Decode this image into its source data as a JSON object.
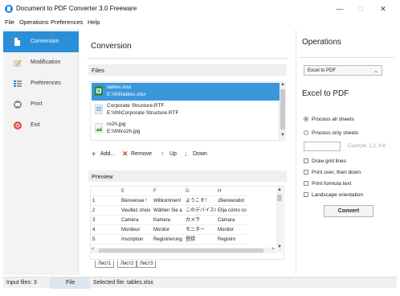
{
  "window": {
    "title": "Document to PDF Converter 3.0 Freeware",
    "min_glyph": "—",
    "max_glyph": "□",
    "close_glyph": "✕"
  },
  "menu": [
    "File",
    "Operations",
    "Preferences",
    "Help"
  ],
  "sidebar": {
    "items": [
      {
        "label": "Conversion",
        "icon": "conversion-icon",
        "active": true
      },
      {
        "label": "Modification",
        "icon": "pencil-icon",
        "active": false
      },
      {
        "label": "Preferences",
        "icon": "preferences-icon",
        "active": false
      },
      {
        "label": "Print",
        "icon": "printer-icon",
        "active": false
      },
      {
        "label": "Exit",
        "icon": "exit-icon",
        "active": false
      }
    ]
  },
  "main": {
    "heading": "Conversion",
    "files_label": "Files",
    "files": [
      {
        "name": "tables.xlsx",
        "path": "E:\\\\IN\\tables.xlsx",
        "selected": true,
        "icon": "excel-file-icon"
      },
      {
        "name": "Corporate Structure.RTF",
        "path": "E:\\\\IN\\Corporate Structure.RTF",
        "selected": false,
        "icon": "rtf-file-icon"
      },
      {
        "name": "ro2h.jpg",
        "path": "E:\\\\IN\\ro2h.jpg",
        "selected": false,
        "icon": "image-file-icon"
      }
    ],
    "toolbar": {
      "add": "Add...",
      "remove": "Remove",
      "up": "Up",
      "down": "Down"
    },
    "preview_label": "Preview",
    "preview": {
      "columns": [
        "",
        "E",
        "F",
        "G",
        "H"
      ],
      "rows": [
        [
          "1",
          "Bienvenue !",
          "Willkommen!",
          "ようこそ！",
          "¡Bienvenido!"
        ],
        [
          "2",
          "Veuillez chois",
          "Wählen Sie a",
          "このデバイスの",
          "Elija cómo co"
        ],
        [
          "3",
          "Caméra",
          "Kamera",
          "カメラ",
          "Cámara"
        ],
        [
          "4",
          "Moniteur",
          "Monitor",
          "モニター",
          "Monitor"
        ],
        [
          "5",
          "Inscription",
          "Registrierung",
          "登録",
          "Registro"
        ]
      ],
      "sheets": [
        "Лист1",
        "Лист2",
        "Лист3"
      ]
    }
  },
  "right": {
    "operations_title": "Operations",
    "operation_selected": "Excel to PDF",
    "section_title": "Excel to PDF",
    "process_all": "Process all sheets",
    "process_only": "Process only sheets",
    "example": "Example: 1,2, 6-8",
    "options": [
      "Draw grid lines",
      "Print over, then down",
      "Print formula text",
      "Landscape orientation"
    ],
    "convert_label": "Convert"
  },
  "status": {
    "input_files": "Input files: 3",
    "mode": "File",
    "selected": "Selected file: tables.xlsx"
  },
  "colors": {
    "accent": "#2b8ed8",
    "selection": "#3a97da"
  }
}
